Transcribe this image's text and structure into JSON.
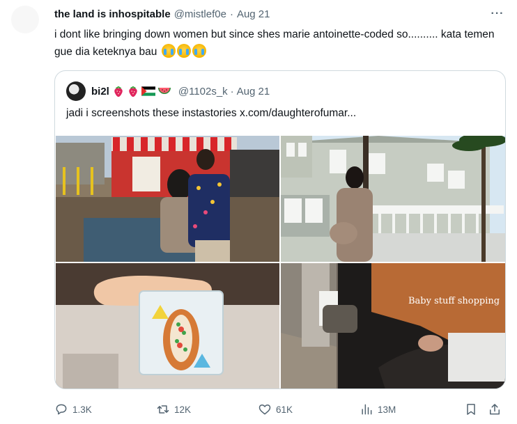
{
  "tweet": {
    "display_name": "the land is inhospitable",
    "handle": "@mistlef0e",
    "separator": "·",
    "date": "Aug 21",
    "text": "i dont like bringing down women but since shes marie antoinette-coded so.......... kata temen gue dia keteknya bau",
    "emoji_icons": [
      "loudly-crying-face-icon",
      "loudly-crying-face-icon",
      "loudly-crying-face-icon"
    ],
    "more_icon": "more-horizontal-icon"
  },
  "quote": {
    "display_name": "bi2l",
    "name_icons": [
      "strawberry-icon",
      "strawberry-icon",
      "palestine-flag-icon",
      "watermelon-icon"
    ],
    "handle": "@1102s_k",
    "separator": "·",
    "date": "Aug 21",
    "text": "jadi i screenshots these instastories  x.com/daughterofumar...",
    "media": [
      {
        "id": "boardwalk-couple-photo"
      },
      {
        "id": "pregnant-woman-house-photo"
      },
      {
        "id": "lobster-roll-photo"
      },
      {
        "id": "stroller-shopping-photo",
        "overlay_text": "Baby stuff shopping"
      }
    ]
  },
  "actions": {
    "replies": "1.3K",
    "retweets": "12K",
    "likes": "61K",
    "views": "13M"
  },
  "colors": {
    "text": "#0f1419",
    "secondary": "#536471",
    "border": "#cfd9de"
  }
}
